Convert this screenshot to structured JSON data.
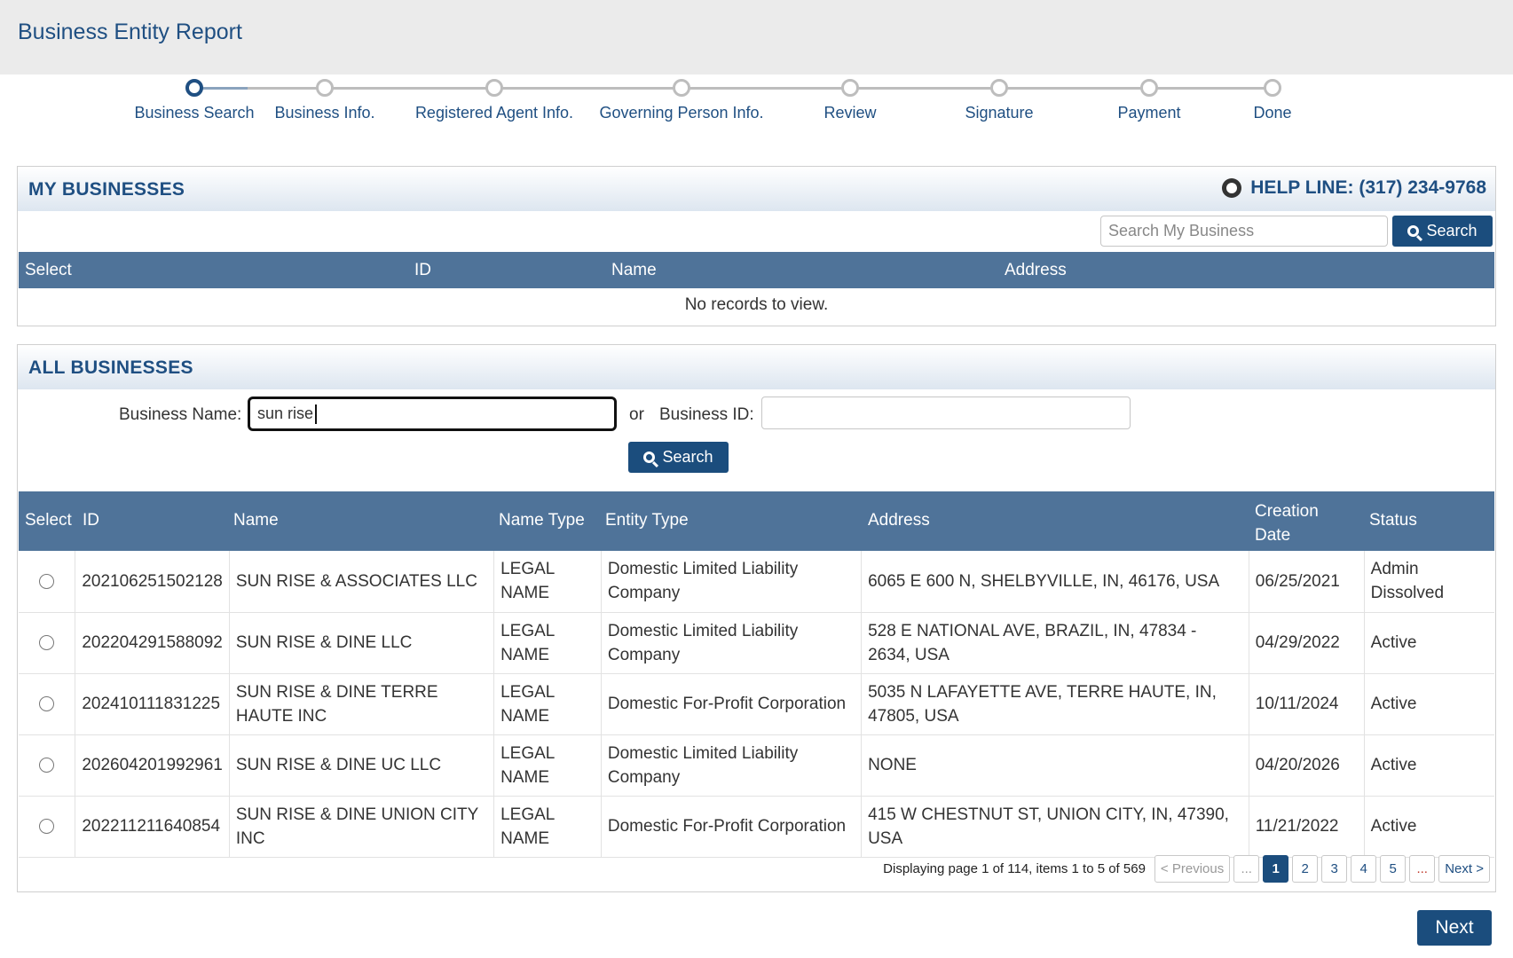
{
  "header": {
    "title": "Business Entity Report"
  },
  "steps": [
    {
      "label": "Business Search",
      "active": true
    },
    {
      "label": "Business Info.",
      "active": false
    },
    {
      "label": "Registered Agent Info.",
      "active": false
    },
    {
      "label": "Governing Person Info.",
      "active": false
    },
    {
      "label": "Review",
      "active": false
    },
    {
      "label": "Signature",
      "active": false
    },
    {
      "label": "Payment",
      "active": false
    },
    {
      "label": "Done",
      "active": false
    }
  ],
  "my_businesses": {
    "title": "MY BUSINESSES",
    "helpline": "HELP LINE: (317) 234-9768",
    "search_placeholder": "Search My Business",
    "search_label": "Search",
    "columns": [
      "Select",
      "ID",
      "Name",
      "Address"
    ],
    "empty_text": "No records to view."
  },
  "all_businesses": {
    "title": "ALL BUSINESSES",
    "name_label": "Business Name:",
    "name_value": "sun rise",
    "or_label": "or",
    "id_label": "Business ID:",
    "id_value": "",
    "search_label": "Search",
    "columns": {
      "select": "Select",
      "id": "ID",
      "name": "Name",
      "name_type": "Name Type",
      "entity_type": "Entity Type",
      "address": "Address",
      "creation_1": "Creation",
      "creation_2": "Date",
      "status": "Status"
    },
    "rows": [
      {
        "id": "202106251502128",
        "name": "SUN RISE & ASSOCIATES LLC",
        "name_type": "LEGAL NAME",
        "entity_type": "Domestic Limited Liability Company",
        "address": "6065 E 600 N, SHELBYVILLE, IN, 46176, USA",
        "date": "06/25/2021",
        "status": "Admin Dissolved"
      },
      {
        "id": "202204291588092",
        "name": "SUN RISE & DINE LLC",
        "name_type": "LEGAL NAME",
        "entity_type": "Domestic Limited Liability Company",
        "address": "528 E NATIONAL AVE, BRAZIL, IN, 47834 - 2634, USA",
        "date": "04/29/2022",
        "status": "Active"
      },
      {
        "id": "202410111831225",
        "name": "SUN RISE & DINE TERRE HAUTE INC",
        "name_type": "LEGAL NAME",
        "entity_type": "Domestic For-Profit Corporation",
        "address": "5035 N LAFAYETTE AVE, TERRE HAUTE, IN, 47805, USA",
        "date": "10/11/2024",
        "status": "Active"
      },
      {
        "id": "202604201992961",
        "name": "SUN RISE & DINE UC LLC",
        "name_type": "LEGAL NAME",
        "entity_type": "Domestic Limited Liability Company",
        "address": "NONE",
        "date": "04/20/2026",
        "status": "Active"
      },
      {
        "id": "202211211640854",
        "name": "SUN RISE & DINE UNION CITY INC",
        "name_type": "LEGAL NAME",
        "entity_type": "Domestic For-Profit Corporation",
        "address": "415 W CHESTNUT ST, UNION CITY, IN, 47390, USA",
        "date": "11/21/2022",
        "status": "Active"
      }
    ],
    "pager": {
      "info": "Displaying page 1 of 114, items 1 to 5 of 569",
      "previous": "< Previous",
      "ellipsis": "...",
      "pages": [
        "1",
        "2",
        "3",
        "4",
        "5"
      ],
      "next": "Next >"
    }
  },
  "footer": {
    "next_label": "Next"
  }
}
